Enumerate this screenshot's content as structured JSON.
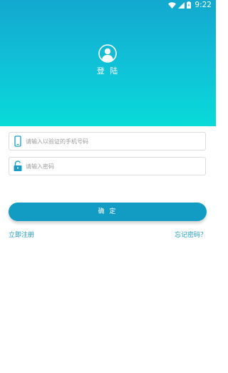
{
  "status_bar": {
    "time": "9:22"
  },
  "header": {
    "title": "登 陆"
  },
  "form": {
    "phone_placeholder": "请输入以验证的手机号码",
    "password_placeholder": "请输入密码"
  },
  "actions": {
    "confirm_label": "确 定",
    "register_label": "立即注册",
    "forgot_label": "忘记密码？"
  },
  "colors": {
    "header_top": "#13a8cf",
    "header_bottom": "#08dbd8",
    "accent": "#129bc3"
  }
}
